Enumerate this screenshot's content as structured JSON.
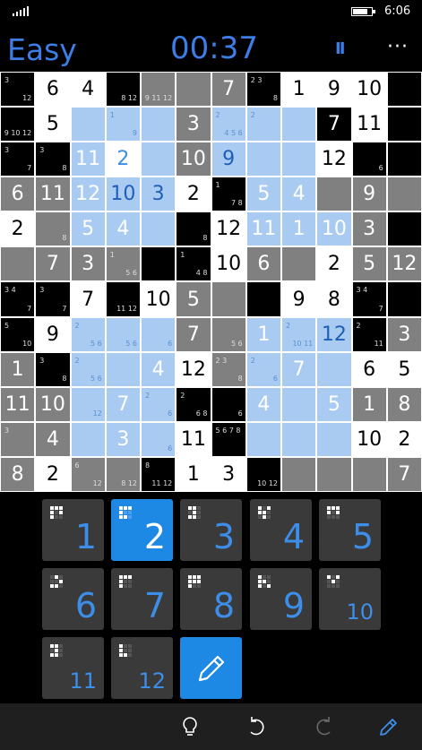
{
  "status": {
    "time": "6:06"
  },
  "header": {
    "difficulty": "Easy",
    "timer": "00:37",
    "pause_icon": "pause-icon",
    "more_icon": "more-icon"
  },
  "colors": {
    "accent": "#3D7DE6",
    "selected": "#1E88E5",
    "light_blue": "#A9CBF1",
    "gray": "#808080",
    "black": "#000000",
    "white": "#FFFFFF"
  },
  "board": {
    "size": 12,
    "rows": [
      [
        "",
        "6",
        "4",
        "",
        "",
        "",
        "7",
        "",
        "1",
        "9",
        "10",
        ""
      ],
      [
        "",
        "5",
        "",
        "",
        "",
        "3",
        "",
        "",
        "",
        "7",
        "11",
        ""
      ],
      [
        "",
        "",
        "11",
        "2",
        "",
        "10",
        "9",
        "",
        "",
        "12",
        "",
        ""
      ],
      [
        "6",
        "11",
        "12",
        "10",
        "3",
        "2",
        "",
        "5",
        "4",
        "",
        "9",
        ""
      ],
      [
        "2",
        "",
        "5",
        "4",
        "",
        "",
        "12",
        "11",
        "1",
        "10",
        "3",
        ""
      ],
      [
        "",
        "7",
        "3",
        "",
        "",
        "",
        "10",
        "6",
        "",
        "2",
        "5",
        "12"
      ],
      [
        "",
        "",
        "7",
        "",
        "10",
        "5",
        "",
        "",
        "9",
        "8",
        "",
        ""
      ],
      [
        "",
        "9",
        "",
        "",
        "",
        "7",
        "",
        "1",
        "",
        "12",
        "",
        "3"
      ],
      [
        "1",
        "",
        "",
        "",
        "4",
        "12",
        "",
        "",
        "7",
        "",
        "6",
        "5"
      ],
      [
        "11",
        "10",
        "",
        "7",
        "",
        "",
        "",
        "4",
        "",
        "5",
        "1",
        "8"
      ],
      [
        "",
        "4",
        "",
        "3",
        "",
        "11",
        "",
        "",
        "",
        "",
        "10",
        "2"
      ],
      [
        "8",
        "2",
        "",
        "",
        "",
        "1",
        "3",
        "",
        "",
        "",
        "",
        "7"
      ]
    ],
    "notes": [
      [
        [
          "3",
          "12"
        ],
        [],
        [],
        [
          "",
          "8 12"
        ],
        [
          "",
          "9 11 12"
        ],
        [
          "",
          ""
        ],
        [],
        [
          "2 3",
          "8"
        ],
        [],
        [],
        [],
        [
          "",
          ""
        ]
      ],
      [
        [
          "",
          "9 10 12"
        ],
        [],
        [
          "",
          ""
        ],
        [
          "1",
          "9"
        ],
        [
          "",
          ""
        ],
        [],
        [
          "2",
          "4 5 6"
        ],
        [
          "2",
          ""
        ],
        [
          "",
          ""
        ],
        [],
        [],
        [
          "",
          ""
        ]
      ],
      [
        [
          "3",
          "7"
        ],
        [
          "3",
          "8"
        ],
        [],
        [],
        [
          "",
          ""
        ],
        [],
        [],
        [
          "",
          ""
        ],
        [
          "",
          ""
        ],
        [],
        [
          "",
          "6"
        ],
        [
          "",
          ""
        ]
      ],
      [
        [],
        [],
        [],
        [],
        [],
        [],
        [
          "1",
          "7 8"
        ],
        [],
        [],
        [
          "",
          ""
        ],
        [],
        [
          "",
          ""
        ]
      ],
      [
        [],
        [
          "",
          "8"
        ],
        [],
        [],
        [
          "",
          ""
        ],
        [
          "",
          "8"
        ],
        [],
        [],
        [],
        [],
        [],
        [
          "",
          ""
        ]
      ],
      [
        [
          "",
          ""
        ],
        [],
        [],
        [
          "1",
          "5 6"
        ],
        [
          "",
          ""
        ],
        [
          "1",
          "4 8"
        ],
        [],
        [],
        [
          "",
          ""
        ],
        [],
        [],
        []
      ],
      [
        [
          "3 4",
          "7"
        ],
        [
          "3",
          "7"
        ],
        [],
        [
          "",
          "11 12"
        ],
        [],
        [],
        [
          "",
          ""
        ],
        [
          "",
          ""
        ],
        [],
        [],
        [
          "3 4",
          "7"
        ],
        [
          "",
          ""
        ]
      ],
      [
        [
          "5",
          "10"
        ],
        [],
        [
          "2",
          "5 6"
        ],
        [
          "",
          "5 6"
        ],
        [
          "",
          "6"
        ],
        [],
        [
          "",
          "5 6"
        ],
        [],
        [
          "2",
          "10 11"
        ],
        [],
        [
          "2",
          "11"
        ],
        []
      ],
      [
        [],
        [
          "3",
          "8"
        ],
        [
          "2",
          "5 6"
        ],
        [
          "",
          ""
        ],
        [],
        [],
        [
          "2 3",
          "8"
        ],
        [
          "2",
          "6"
        ],
        [],
        [
          "",
          ""
        ],
        [],
        []
      ],
      [
        [],
        [],
        [
          "",
          "12"
        ],
        [],
        [
          "2",
          "6"
        ],
        [
          "2",
          "6 8"
        ],
        [
          "",
          "6"
        ],
        [],
        [
          "",
          ""
        ],
        [],
        [],
        []
      ],
      [
        [
          "3",
          ""
        ],
        [],
        [
          "",
          ""
        ],
        [],
        [
          "",
          "6"
        ],
        [],
        [
          "5 6 7 8",
          ""
        ],
        [
          "",
          ""
        ],
        [
          "",
          ""
        ],
        [
          "",
          ""
        ],
        [],
        []
      ],
      [
        [],
        [],
        [
          "6",
          "12"
        ],
        [
          "",
          "8 12"
        ],
        [
          "8",
          "11 12"
        ],
        [],
        [],
        [
          "",
          "10 12"
        ],
        [
          "",
          ""
        ],
        [
          "",
          ""
        ],
        [
          "",
          ""
        ],
        []
      ]
    ],
    "fills": [
      [
        "k",
        "w",
        "w",
        "k",
        "g",
        "g",
        "g",
        "k",
        "w",
        "w",
        "w",
        "k"
      ],
      [
        "k",
        "w",
        "b",
        "b",
        "b",
        "g",
        "b",
        "b",
        "b",
        "k",
        "w",
        "k"
      ],
      [
        "k",
        "k",
        "b",
        "s",
        "b",
        "g",
        "b",
        "b",
        "b",
        "w",
        "k",
        "k"
      ],
      [
        "g",
        "g",
        "b",
        "b",
        "b",
        "w",
        "k",
        "b",
        "b",
        "g",
        "g",
        "g"
      ],
      [
        "w",
        "g",
        "b",
        "b",
        "b",
        "k",
        "w",
        "b",
        "b",
        "b",
        "g",
        "k"
      ],
      [
        "g",
        "g",
        "g",
        "g",
        "k",
        "k",
        "w",
        "g",
        "g",
        "w",
        "g",
        "g"
      ],
      [
        "k",
        "k",
        "w",
        "k",
        "w",
        "g",
        "g",
        "k",
        "w",
        "w",
        "k",
        "k"
      ],
      [
        "k",
        "w",
        "b",
        "b",
        "b",
        "g",
        "g",
        "b",
        "b",
        "b",
        "k",
        "g"
      ],
      [
        "g",
        "k",
        "b",
        "b",
        "b",
        "w",
        "g",
        "b",
        "b",
        "b",
        "w",
        "w"
      ],
      [
        "g",
        "g",
        "b",
        "b",
        "b",
        "k",
        "k",
        "b",
        "b",
        "b",
        "g",
        "g"
      ],
      [
        "g",
        "g",
        "b",
        "b",
        "b",
        "w",
        "k",
        "b",
        "b",
        "b",
        "w",
        "w"
      ],
      [
        "g",
        "w",
        "g",
        "g",
        "k",
        "w",
        "w",
        "k",
        "g",
        "g",
        "g",
        "g"
      ]
    ],
    "blue_values": [
      [
        2,
        3
      ],
      [
        3,
        3
      ],
      [
        3,
        4
      ],
      [
        2,
        6
      ],
      [
        7,
        9
      ]
    ]
  },
  "keypad": {
    "keys": [
      {
        "label": "1",
        "icon": "shape-1-icon",
        "selected": false,
        "pattern": [
          "111",
          "1 1",
          "1  "
        ]
      },
      {
        "label": "2",
        "icon": "shape-2-icon",
        "selected": true,
        "pattern": [
          "111",
          "1  ",
          "11 "
        ]
      },
      {
        "label": "3",
        "icon": "shape-3-icon",
        "selected": false,
        "pattern": [
          "11 ",
          " 1 ",
          "11 "
        ]
      },
      {
        "label": "4",
        "icon": "shape-4-icon",
        "selected": false,
        "pattern": [
          "1 1",
          "11 ",
          " 1 "
        ]
      },
      {
        "label": "5",
        "icon": "shape-5-icon",
        "selected": false,
        "pattern": [
          "111",
          "1 1",
          "   "
        ]
      },
      {
        "label": "6",
        "icon": "shape-6-icon",
        "selected": false,
        "pattern": [
          " 1 ",
          "  1",
          "11 "
        ]
      },
      {
        "label": "7",
        "icon": "shape-7-icon",
        "selected": false,
        "pattern": [
          "111",
          "1  ",
          "1  "
        ]
      },
      {
        "label": "8",
        "icon": "shape-8-icon",
        "selected": false,
        "pattern": [
          "111",
          "111",
          "1  "
        ]
      },
      {
        "label": "9",
        "icon": "shape-9-icon",
        "selected": false,
        "pattern": [
          "1  ",
          "11 ",
          "1 1"
        ]
      },
      {
        "label": "10",
        "icon": "shape-10-icon",
        "selected": false,
        "pattern": [
          "1 1",
          " 1 ",
          "   "
        ]
      },
      {
        "label": "11",
        "icon": "shape-11-icon",
        "selected": false,
        "pattern": [
          "11 ",
          " 1 ",
          "11 "
        ]
      },
      {
        "label": "12",
        "icon": "shape-12-icon",
        "selected": false,
        "pattern": [
          "1  ",
          "1  ",
          "11 "
        ]
      }
    ],
    "pencil_icon": "pencil-icon"
  },
  "appbar": {
    "items": [
      "hint-icon",
      "undo-icon",
      "redo-icon",
      "edit-icon"
    ]
  }
}
